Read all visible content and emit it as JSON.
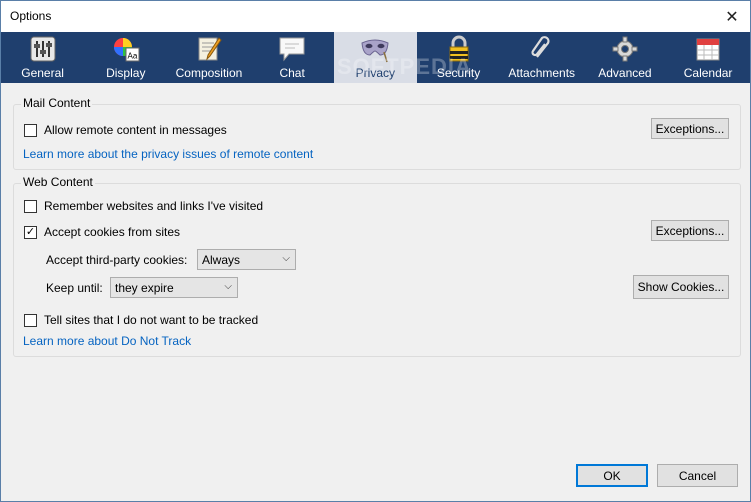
{
  "window": {
    "title": "Options"
  },
  "tabs": [
    {
      "label": "General",
      "icon": "sliders-icon"
    },
    {
      "label": "Display",
      "icon": "color-wheel-icon"
    },
    {
      "label": "Composition",
      "icon": "compose-icon"
    },
    {
      "label": "Chat",
      "icon": "chat-bubble-icon"
    },
    {
      "label": "Privacy",
      "icon": "mask-icon",
      "selected": true
    },
    {
      "label": "Security",
      "icon": "lock-icon"
    },
    {
      "label": "Attachments",
      "icon": "paperclip-icon"
    },
    {
      "label": "Advanced",
      "icon": "gear-icon"
    },
    {
      "label": "Calendar",
      "icon": "calendar-icon"
    }
  ],
  "watermark": "SOFTPEDIA",
  "mail_content": {
    "title": "Mail Content",
    "allow_remote": {
      "label": "Allow remote content in messages",
      "checked": false
    },
    "exceptions_label": "Exceptions...",
    "learn_more": "Learn more about the privacy issues of remote content"
  },
  "web_content": {
    "title": "Web Content",
    "remember": {
      "label": "Remember websites and links I've visited",
      "checked": false
    },
    "accept_cookies": {
      "label": "Accept cookies from sites",
      "checked": true
    },
    "exceptions_label": "Exceptions...",
    "third_party": {
      "label": "Accept third-party cookies:",
      "value": "Always"
    },
    "keep_until": {
      "label": "Keep until:",
      "value": "they expire"
    },
    "show_cookies_label": "Show Cookies...",
    "dnt": {
      "label": "Tell sites that I do not want to be tracked",
      "checked": false
    },
    "dnt_link": "Learn more about Do Not Track"
  },
  "footer": {
    "ok": "OK",
    "cancel": "Cancel"
  },
  "colors": {
    "toolbar": "#1f3f6e",
    "link": "#0563c1",
    "selected_tab": "#d9dde6"
  }
}
